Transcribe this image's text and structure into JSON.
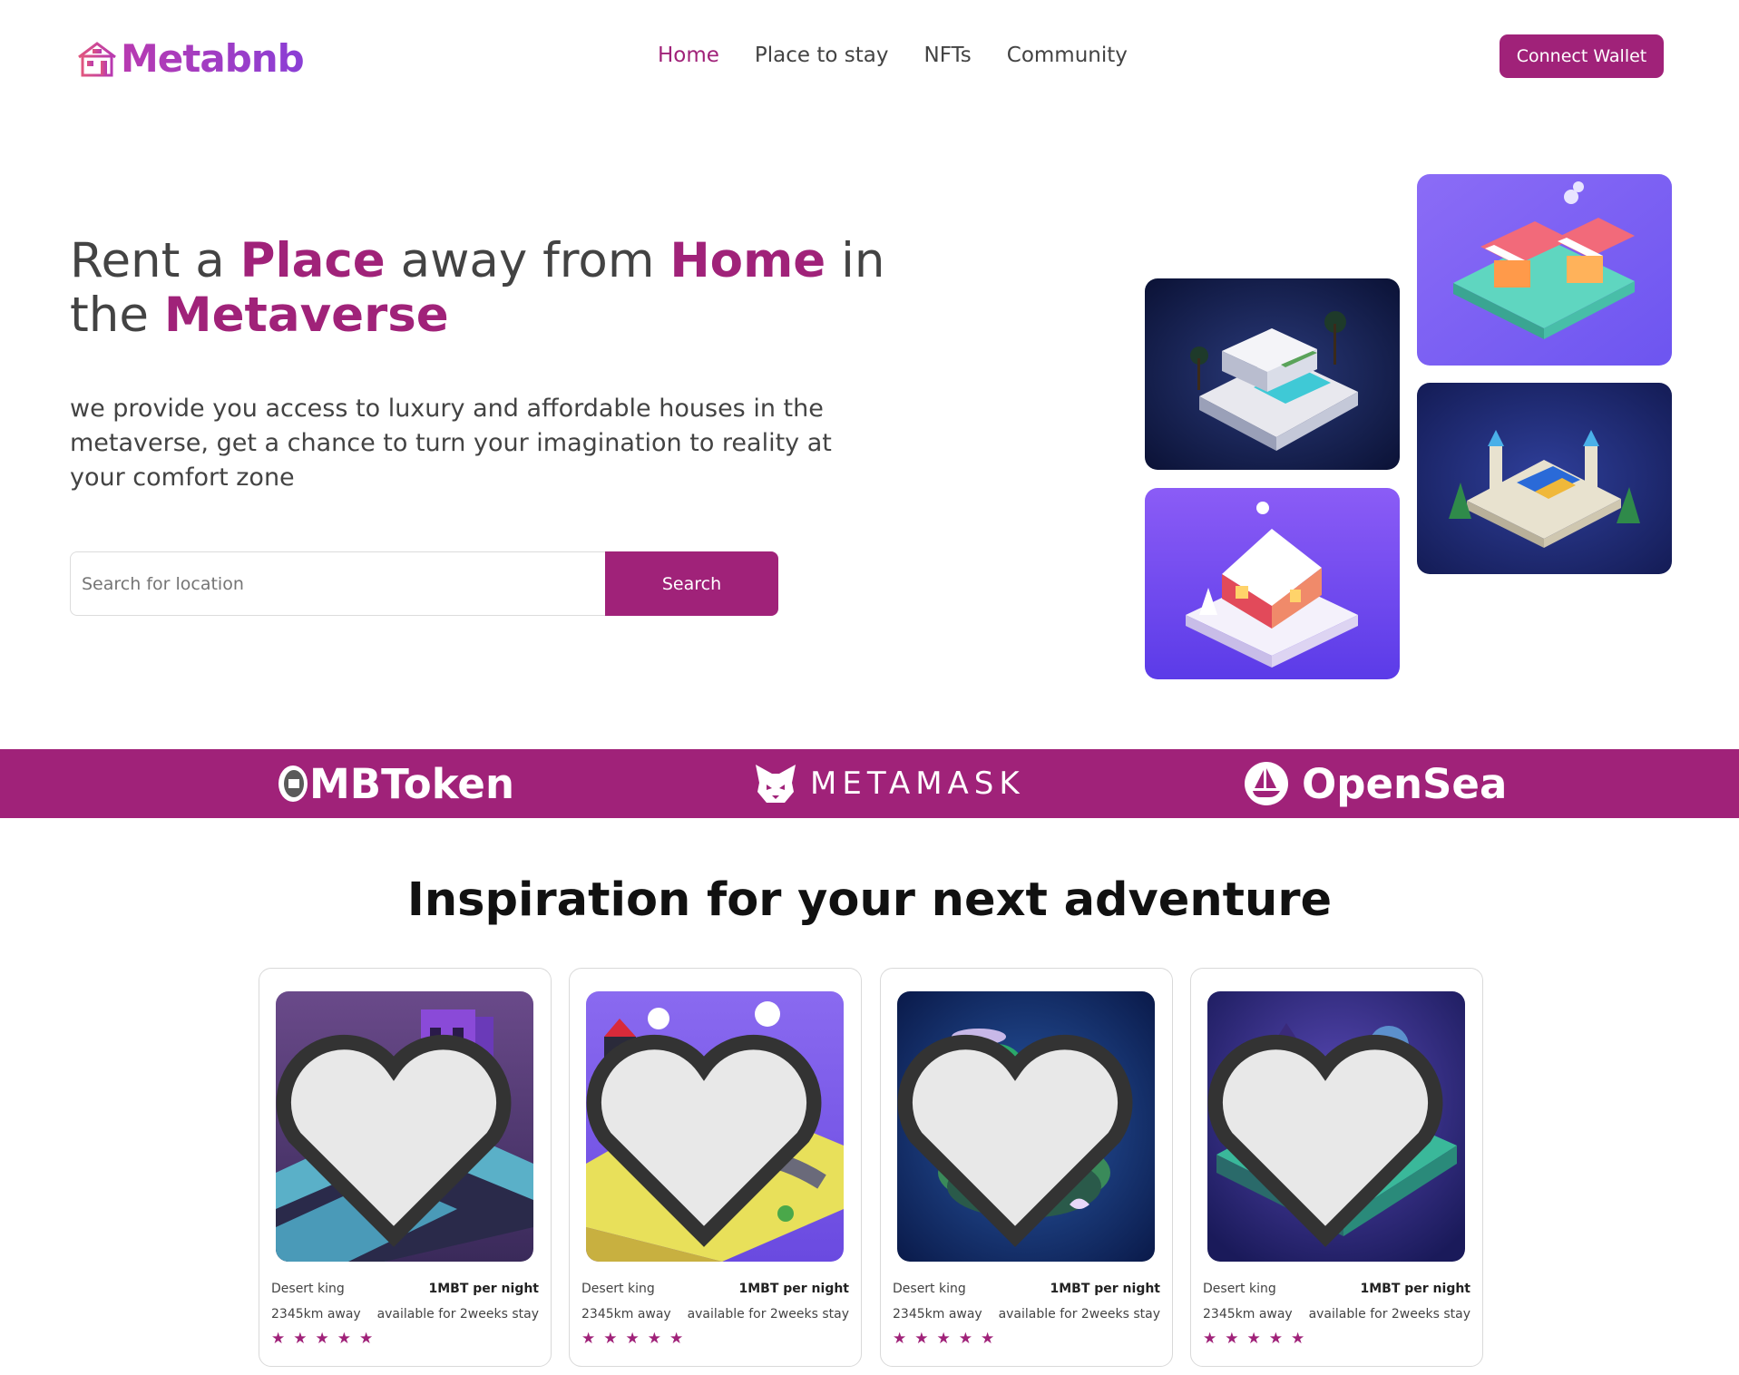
{
  "header": {
    "logo_text": "Metabnb",
    "nav": [
      "Home",
      "Place to stay",
      "NFTs",
      "Community"
    ],
    "active_nav": "Home",
    "connect_label": "Connect Wallet"
  },
  "hero": {
    "title_parts": [
      "Rent a ",
      "Place",
      " away from ",
      "Home",
      " in the ",
      "Metaverse"
    ],
    "description": "we provide you access to luxury and affordable houses in the metaverse, get a chance to turn your imagination to reality at your comfort zone",
    "search_placeholder": "Search for location",
    "search_label": "Search"
  },
  "partners": [
    "MBToken",
    "METAMASK",
    "OpenSea"
  ],
  "inspiration": {
    "title": "Inspiration for your next adventure",
    "cards": [
      {
        "name": "Desert king",
        "price": "1MBT per night",
        "distance": "2345km away",
        "availability": "available for 2weeks stay",
        "rating": 5
      },
      {
        "name": "Desert king",
        "price": "1MBT per night",
        "distance": "2345km away",
        "availability": "available for 2weeks stay",
        "rating": 5
      },
      {
        "name": "Desert king",
        "price": "1MBT per night",
        "distance": "2345km away",
        "availability": "available for 2weeks stay",
        "rating": 5
      },
      {
        "name": "Desert king",
        "price": "1MBT per night",
        "distance": "2345km away",
        "availability": "available for 2weeks stay",
        "rating": 5
      }
    ]
  },
  "colors": {
    "brand": "#a02279",
    "text": "#434343",
    "band": "#a02279"
  }
}
